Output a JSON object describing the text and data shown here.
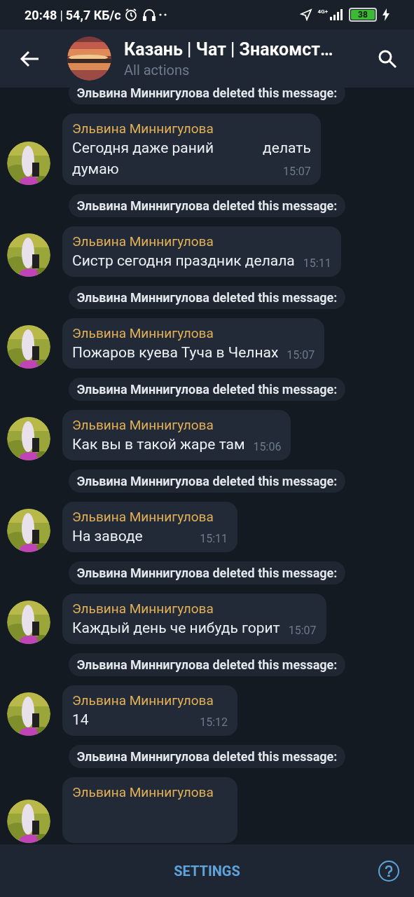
{
  "status_bar": {
    "time": "20:48",
    "separator": "|",
    "speed": "54,7 КБ/с",
    "network": "4G+",
    "battery": "38"
  },
  "header": {
    "title": "Казань | Чат | Знакомст…",
    "subtitle": "All actions"
  },
  "items": [
    {
      "kind": "service",
      "text": "Эльвина Миннигулова deleted this message:"
    },
    {
      "kind": "message",
      "author": "Эльвина Миннигулова",
      "lines": [
        [
          "Сегодня даже раний",
          "делать"
        ],
        [
          "думаю"
        ]
      ],
      "time": "15:07"
    },
    {
      "kind": "service",
      "text": "Эльвина Миннигулова deleted this message:"
    },
    {
      "kind": "message",
      "author": "Эльвина Миннигулова",
      "lines": [
        [
          "Систр сегодня праздник делала"
        ]
      ],
      "time": "15:11"
    },
    {
      "kind": "service",
      "text": "Эльвина Миннигулова deleted this message:"
    },
    {
      "kind": "message",
      "author": "Эльвина Миннигулова",
      "lines": [
        [
          "Пожаров куева Туча в Челнах"
        ]
      ],
      "time": "15:07"
    },
    {
      "kind": "service",
      "text": "Эльвина Миннигулова deleted this message:"
    },
    {
      "kind": "message",
      "author": "Эльвина Миннигулова",
      "lines": [
        [
          "Как вы в такой жаре там"
        ]
      ],
      "time": "15:06"
    },
    {
      "kind": "service",
      "text": "Эльвина Миннигулова deleted this message:"
    },
    {
      "kind": "message",
      "author": "Эльвина Миннигулова",
      "lines": [
        [
          "На заводе"
        ]
      ],
      "time": "15:11"
    },
    {
      "kind": "service",
      "text": "Эльвина Миннигулова deleted this message:"
    },
    {
      "kind": "message",
      "author": "Эльвина Миннигулова",
      "lines": [
        [
          "Каждый день че нибудь горит"
        ]
      ],
      "time": "15:07"
    },
    {
      "kind": "service",
      "text": "Эльвина Миннигулова deleted this message:"
    },
    {
      "kind": "message",
      "author": "Эльвина Миннигулова",
      "lines": [
        [
          "14"
        ]
      ],
      "time": "15:12"
    },
    {
      "kind": "service",
      "text": "Эльвина Миннигулова deleted this message:"
    },
    {
      "kind": "message",
      "author": "Эльвина Миннигулова"
    }
  ],
  "bottom_bar": {
    "button": "SETTINGS"
  }
}
